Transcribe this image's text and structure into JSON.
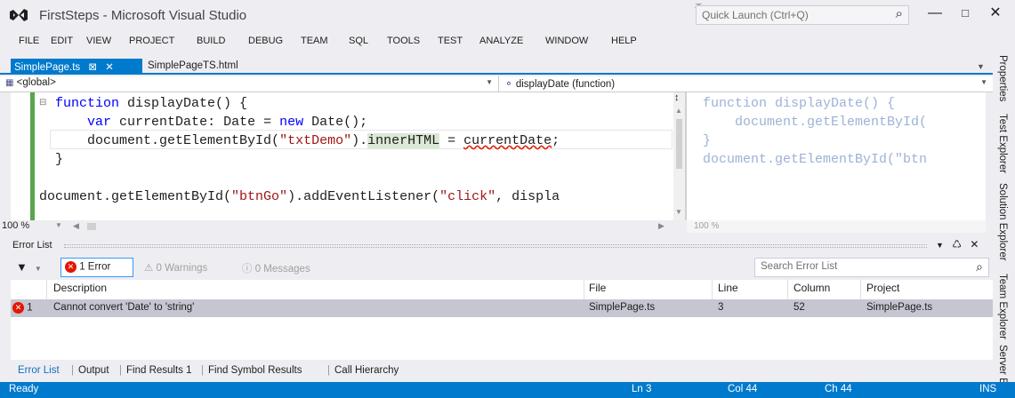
{
  "title_bar": {
    "title": "FirstSteps - Microsoft Visual Studio",
    "quick_launch_placeholder": "Quick Launch (Ctrl+Q)"
  },
  "menu": [
    "FILE",
    "EDIT",
    "VIEW",
    "PROJECT",
    "BUILD",
    "DEBUG",
    "TEAM",
    "SQL",
    "TOOLS",
    "TEST",
    "ANALYZE",
    "WINDOW",
    "HELP"
  ],
  "tabs": {
    "active": "SimplePage.ts",
    "inactive": "SimplePageTS.html"
  },
  "nav": {
    "scope": "<global>",
    "member": "displayDate (function)"
  },
  "editor": {
    "line1_kw": "function",
    "line1_rest": " displayDate() {",
    "line2_indent": "    ",
    "line2_kw": "var",
    "line2_mid": " currentDate: Date = ",
    "line2_kw2": "new",
    "line2_rest": " Date();",
    "line3_a": "    document.getElementById(",
    "line3_str": "\"txtDemo\"",
    "line3_b": ").",
    "line3_hl": "innerHTML",
    "line3_c": " = ",
    "line3_err": "currentDate",
    "line3_d": ";",
    "line4": "}",
    "line6_a": "document.getElementById(",
    "line6_str": "\"btnGo\"",
    "line6_b": ").addEventListener(",
    "line6_str2": "\"click\"",
    "line6_c": ", displa",
    "zoom": "100 %"
  },
  "preview": {
    "line1": "function displayDate() {",
    "line2": "    document.getElementById(",
    "line3": "}",
    "line4": "document.getElementById(\"btn",
    "zoom": "100 %"
  },
  "error_list": {
    "title": "Error List",
    "errors_btn": "1 Error",
    "warnings_btn": "0 Warnings",
    "messages_btn": "0 Messages",
    "search_placeholder": "Search Error List",
    "columns": [
      "Description",
      "File",
      "Line",
      "Column",
      "Project"
    ],
    "rows": [
      {
        "num": "1",
        "description": "Cannot convert 'Date' to 'string'",
        "file": "SimplePage.ts",
        "line": "3",
        "column": "52",
        "project": "SimplePage.ts"
      }
    ]
  },
  "bottom_tabs": [
    "Error List",
    "Output",
    "Find Results 1",
    "Find Symbol Results",
    "Call Hierarchy"
  ],
  "side_tabs": [
    "Properties",
    "Test Explorer",
    "Solution Explorer",
    "Team Explorer",
    "Server E"
  ],
  "status": {
    "ready": "Ready",
    "ln": "Ln 3",
    "col": "Col 44",
    "ch": "Ch 44",
    "ins": "INS"
  },
  "colors": {
    "accent": "#007acc",
    "error": "#e51400",
    "keyword": "#0000ff",
    "string": "#a31515"
  }
}
